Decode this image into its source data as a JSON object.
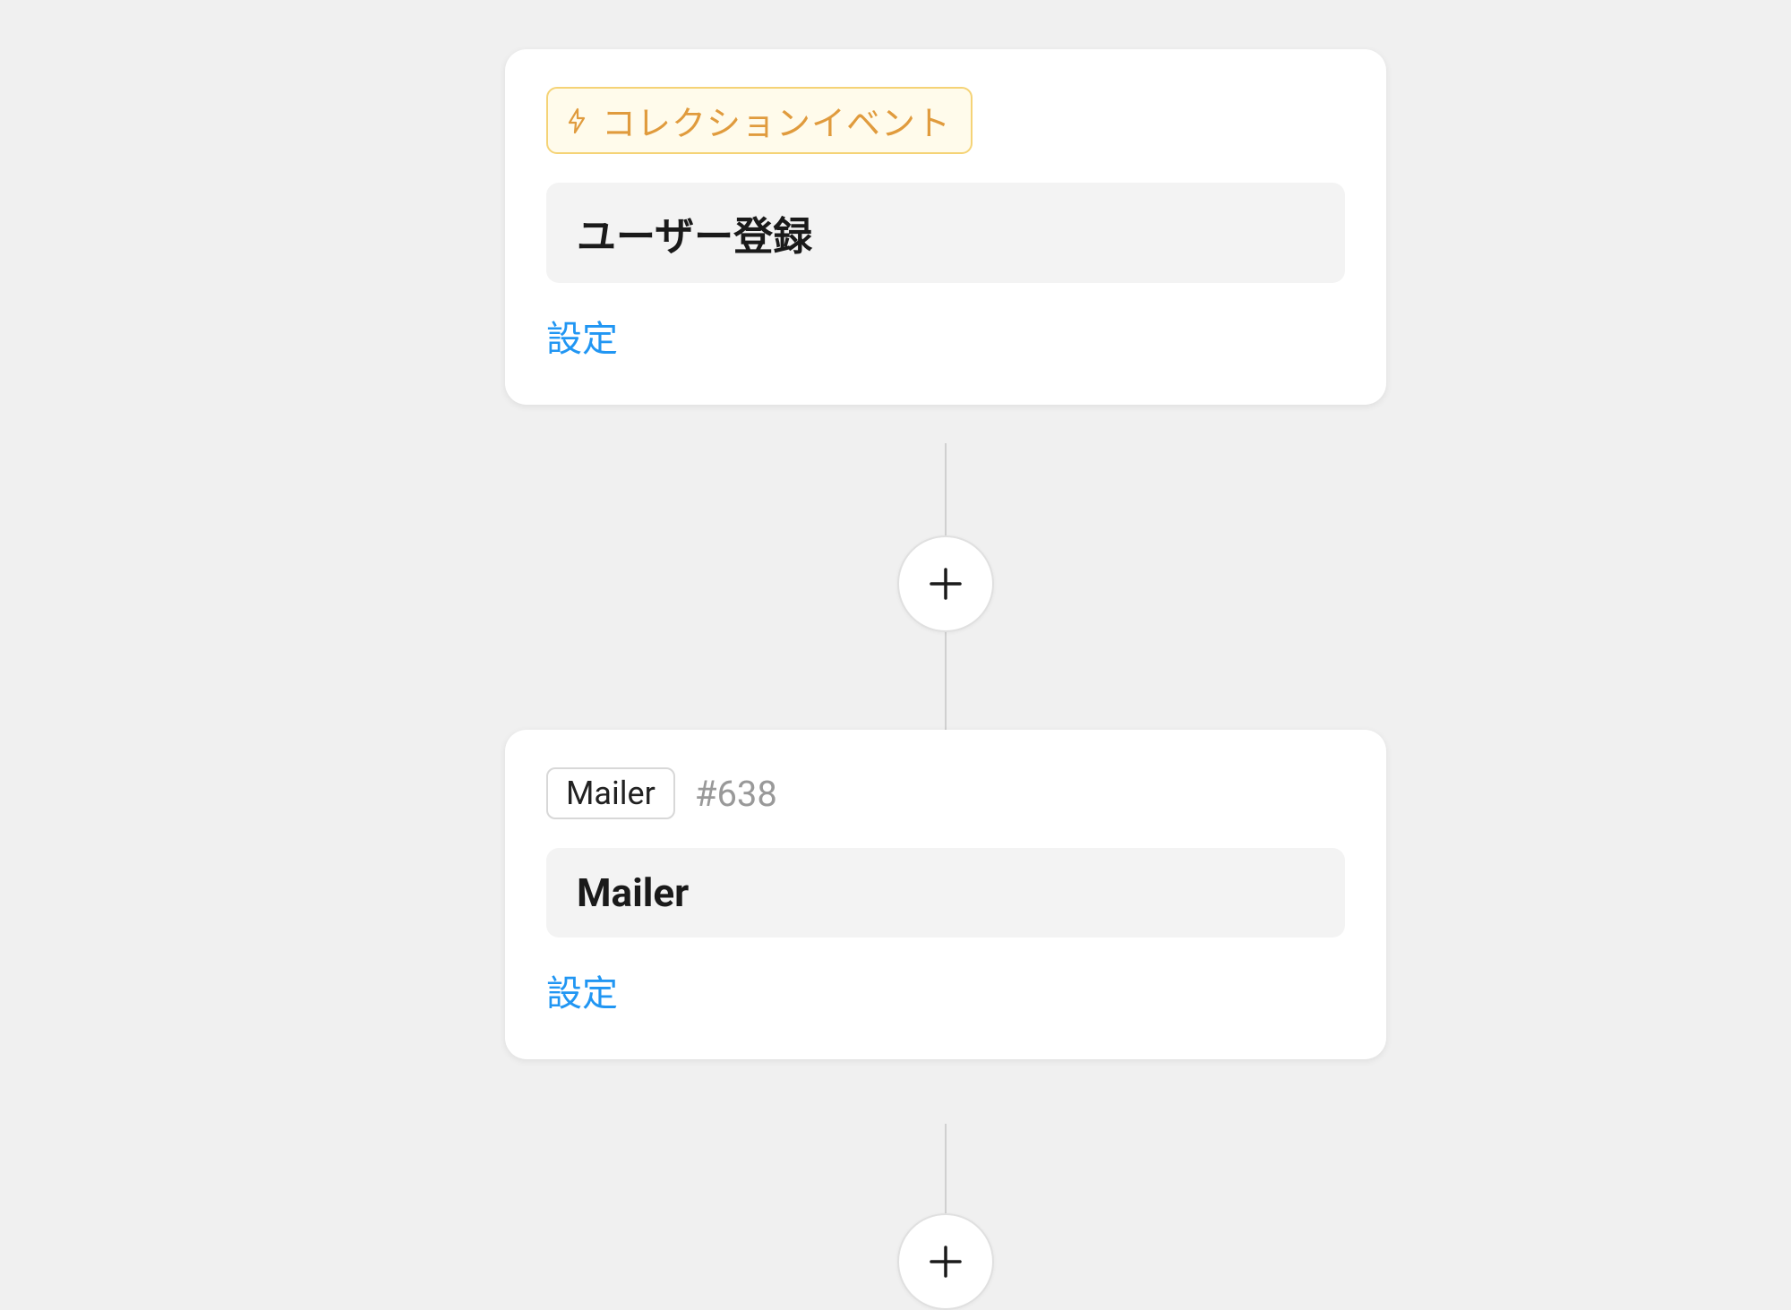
{
  "workflow": {
    "nodes": [
      {
        "badge": {
          "type": "event",
          "label": "コレクションイベント"
        },
        "title": "ユーザー登録",
        "settings_label": "設定"
      },
      {
        "badge": {
          "type": "plain",
          "label": "Mailer",
          "id": "#638"
        },
        "title": "Mailer",
        "settings_label": "設定"
      }
    ]
  },
  "colors": {
    "event_badge_bg": "#fffbeb",
    "event_badge_border": "#f5d376",
    "event_badge_text": "#e09b3d",
    "link": "#2196f3",
    "card_bg": "#ffffff",
    "page_bg": "#f0f0f0"
  }
}
